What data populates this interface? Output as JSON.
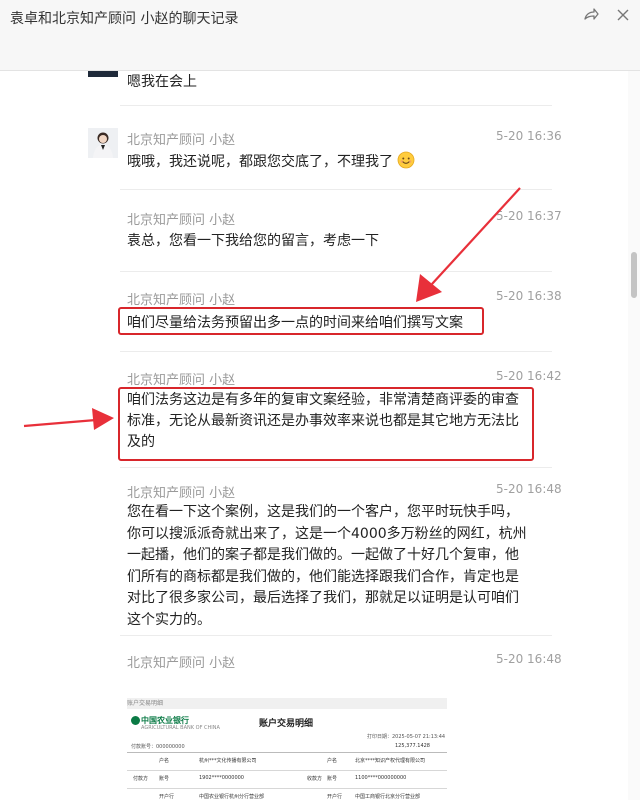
{
  "window": {
    "title": "袁卓和北京知产顾问 小赵的聊天记录"
  },
  "messages": [
    {
      "text": "嗯我在会上"
    },
    {
      "sender": "北京知产顾问 小赵",
      "time": "5-20 16:36",
      "text": "哦哦，我还说呢，都跟您交底了，不理我了"
    },
    {
      "sender": "北京知产顾问 小赵",
      "time": "5-20 16:37",
      "text": "袁总，您看一下我给您的留言，考虑一下"
    },
    {
      "sender": "北京知产顾问 小赵",
      "time": "5-20 16:38",
      "text": "咱们尽量给法务预留出多一点的时间来给咱们撰写文案"
    },
    {
      "sender": "北京知产顾问 小赵",
      "time": "5-20 16:42",
      "lines": [
        "咱们法务这边是有多年的复审文案经验，非常清楚商评委的审查",
        "标准，无论从最新资讯还是办事效率来说也都是其它地方无法比",
        "及的"
      ]
    },
    {
      "sender": "北京知产顾问 小赵",
      "time": "5-20 16:48",
      "lines": [
        "您在看一下这个案例，这是我们的一个客户，您平时玩快手吗，",
        "你可以搜派派奇就出来了，这是一个4000多万粉丝的网红，杭州",
        "一起播，他们的案子都是我们做的。一起做了十好几个复审，他",
        "们所有的商标都是我们做的，他们能选择跟我们合作，肯定也是",
        "对比了很多家公司，最后选择了我们，那就足以证明是认可咱们",
        "这个实力的。"
      ]
    },
    {
      "sender": "北京知产顾问 小赵",
      "time": "5-20 16:48"
    }
  ],
  "receipt": {
    "header": "账户交易明细",
    "bank_name": "中国农业银行",
    "bank_sub": "AGRICULTURAL BANK OF CHINA",
    "title": "账户交易明细",
    "time": "打印日期：2025-05-07 21:13:44",
    "account": "付款账号：000000000",
    "total": "125,377.1428",
    "cells": [
      {
        "label": "户名",
        "value": "杭州***文化传播有限公司",
        "label2": "户名",
        "value2": "北京****知识产权代理有限公司"
      },
      {
        "label": "账号",
        "value": "1902****0000000",
        "label2": "账号",
        "value2": "1100****000000000"
      },
      {
        "label": "开户行",
        "value": "中国农业银行杭州分行营业部",
        "label2": "开户行",
        "value2": "中国工商银行北京分行营业部"
      }
    ],
    "side_label": "付款方",
    "side_label2": "收款方"
  },
  "colors": {
    "highlight": "#d8262b",
    "arrow": "#e8303a",
    "sender": "#9a9a9a",
    "time": "#a0a0a0"
  },
  "icons": {
    "share": "share-icon",
    "close": "close-icon",
    "emoji": "smiley-emoji-icon"
  }
}
